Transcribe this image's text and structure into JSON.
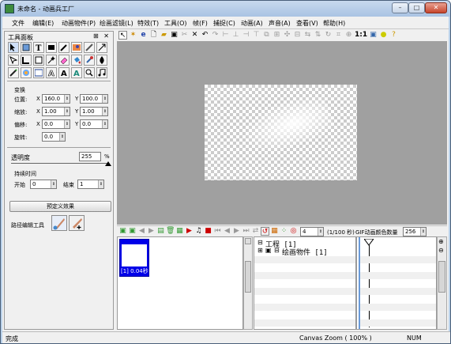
{
  "window": {
    "title": "未命名 - 动画兵工厂"
  },
  "menu": [
    "文件",
    "编辑(E)",
    "动画物件(P)",
    "绘画滤镜(L)",
    "特效(T)",
    "工具(O)",
    "帧(F)",
    "捕捉(C)",
    "动画(A)",
    "声音(A)",
    "查看(V)",
    "帮助(H)"
  ],
  "panel": {
    "title": "工具面板",
    "transform_label": "变换",
    "position_label": "位置:",
    "position_x": "160.0",
    "position_y": "100.0",
    "scale_label": "缩放:",
    "scale_x": "1.00",
    "scale_y": "1.00",
    "skew_label": "偏移:",
    "skew_x": "0.0",
    "skew_y": "0.0",
    "rotate_label": "旋转:",
    "rotate_value": "0.0",
    "x_label": "X",
    "y_label": "Y",
    "opacity_label": "透明度",
    "opacity_value": "255",
    "opacity_unit": "%",
    "duration_label": "持续时间",
    "start_label": "开始",
    "start_value": "0",
    "end_label": "结束",
    "end_value": "1",
    "preset_button": "预定义效果",
    "path_tool_label": "路径编辑工具"
  },
  "canvas_toolbar": {
    "ratio_label": "1:1"
  },
  "timeline": {
    "frame_field": "4",
    "frame_suffix": "(1/100 秒)",
    "gif_label": "GIF动画颜色数量",
    "gif_value": "256",
    "frame_caption": "[1] 0.04秒",
    "tree_root": "工程 [1]",
    "tree_child": "绘画物件 [1]"
  },
  "status": {
    "left": "完成",
    "zoom": "Canvas Zoom ( 100% )",
    "num": "NUM"
  }
}
